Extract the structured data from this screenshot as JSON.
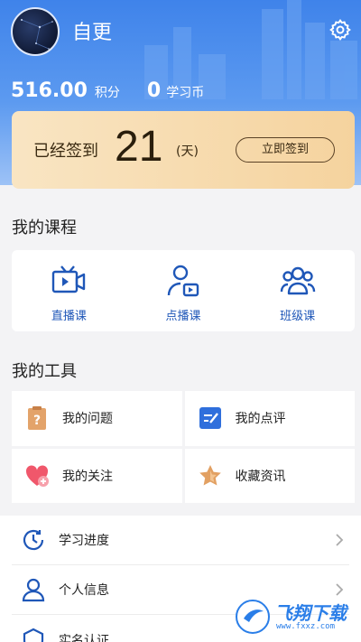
{
  "profile": {
    "username": "自更",
    "points_value": "516.00",
    "points_unit": "积分",
    "coins_value": "0",
    "coins_unit": "学习币"
  },
  "checkin": {
    "label": "已经签到",
    "days": "21",
    "unit": "(天)",
    "button": "立即签到"
  },
  "courses": {
    "title": "我的课程",
    "items": [
      {
        "label": "直播课",
        "icon": "live-video-icon"
      },
      {
        "label": "点播课",
        "icon": "user-play-icon"
      },
      {
        "label": "班级课",
        "icon": "group-icon"
      }
    ]
  },
  "tools": {
    "title": "我的工具",
    "items": [
      {
        "label": "我的问题",
        "icon": "question-clipboard-icon"
      },
      {
        "label": "我的点评",
        "icon": "comment-edit-icon"
      },
      {
        "label": "我的关注",
        "icon": "heart-plus-icon"
      },
      {
        "label": "收藏资讯",
        "icon": "star-icon"
      }
    ]
  },
  "menu": {
    "items": [
      {
        "label": "学习进度",
        "icon": "clock-icon"
      },
      {
        "label": "个人信息",
        "icon": "person-icon"
      },
      {
        "label": "实名认证",
        "icon": "shield-icon"
      }
    ]
  },
  "watermark": {
    "text": "飞翔下载",
    "url": "www.fxxz.com"
  },
  "colors": {
    "header_blue": "#3f83ea",
    "accent_blue": "#1f57b8",
    "gold_card": "#f5d39e",
    "heart": "#f0576b",
    "star": "#e2a062",
    "question": "#e3a36a"
  }
}
